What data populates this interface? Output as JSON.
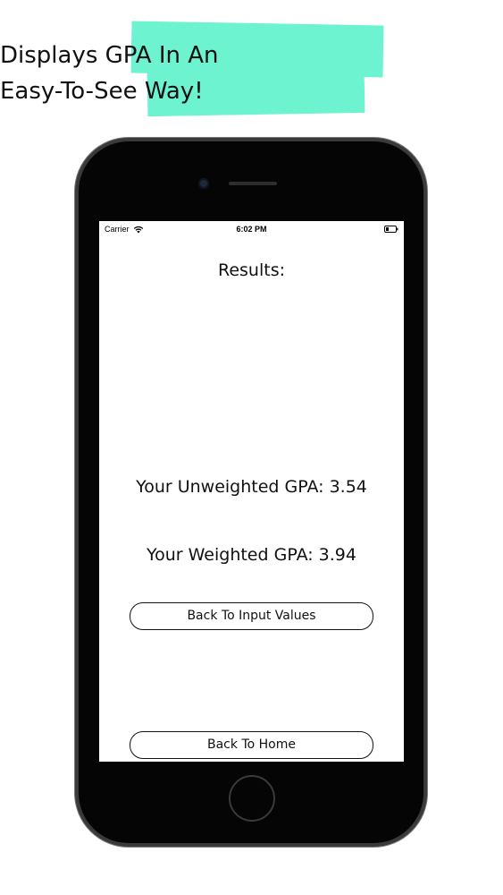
{
  "headline": {
    "line1": "Displays GPA In An",
    "line2": "Easy-To-See Way!",
    "marker_color": "#6ef3d0"
  },
  "status_bar": {
    "carrier": "Carrier",
    "time": "6:02 PM",
    "icons": [
      "wifi-icon",
      "battery-icon"
    ]
  },
  "results": {
    "title": "Results:",
    "unweighted": "Your Unweighted GPA: 3.54",
    "weighted": "Your Weighted GPA: 3.94"
  },
  "buttons": {
    "back_to_input": "Back To Input Values",
    "back_to_home": "Back To Home"
  }
}
